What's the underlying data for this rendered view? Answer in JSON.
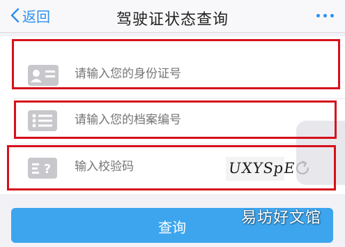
{
  "nav": {
    "back_label": "返回",
    "title": "驾驶证状态查询"
  },
  "form": {
    "id_placeholder": "请输入您的身份证号",
    "file_placeholder": "请输入您的档案编号",
    "code_placeholder": "输入校验码",
    "captcha_text": "UXYSpE"
  },
  "actions": {
    "query_label": "查询"
  },
  "watermark": "易坊好文馆",
  "colors": {
    "accent": "#2b8ff0",
    "button": "#3da5ee",
    "highlight_box": "#d6101c",
    "icon_gray": "#c8c8cc"
  }
}
